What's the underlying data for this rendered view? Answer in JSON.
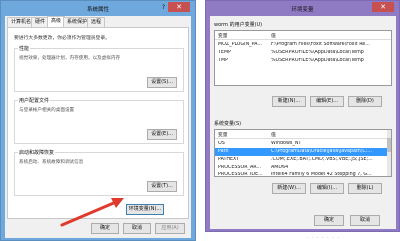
{
  "sysprops": {
    "title": "系统属性",
    "close_glyph": "✕",
    "help_glyph": "?",
    "tabs": [
      "计算机名",
      "硬件",
      "高级",
      "系统保护",
      "远程"
    ],
    "note": "要进行大多数更改，你必须作为管理员登录。",
    "groups": [
      {
        "title": "性能",
        "desc": "视觉效果，处理器计划，内存使用，以及虚拟内存",
        "button": "设置(S)..."
      },
      {
        "title": "用户配置文件",
        "desc": "与登录帐户相关的桌面设置",
        "button": "设置(E)..."
      },
      {
        "title": "启动和故障恢复",
        "desc": "系统启动、系统故障和调试信息",
        "button": "设置(T)..."
      }
    ],
    "env_button": "环境变量(N)...",
    "ok": "确定",
    "cancel": "取消",
    "apply": "应用(A)"
  },
  "envvars": {
    "title": "环境变量",
    "close_glyph": "✕",
    "user_section": "worm 的用户变量(U)",
    "system_section": "系统变量(S)",
    "col_var": "变量",
    "col_val": "值",
    "user_vars": [
      {
        "name": "MOZ_PLUGIN_PA...",
        "value": "F:\\Program Files\\Foxit Software\\Foxit Re..."
      },
      {
        "name": "TEMP",
        "value": "%USERPROFILE%\\AppData\\Local\\Temp"
      },
      {
        "name": "TMP",
        "value": "%USERPROFILE%\\AppData\\Local\\Temp"
      }
    ],
    "system_vars": [
      {
        "name": "OS",
        "value": "Windows_NT"
      },
      {
        "name": "Path",
        "value": "C:\\ProgramData\\Oracle\\Java\\javapath;C:..."
      },
      {
        "name": "PATHEXT",
        "value": ".COM;.EXE;.BAT;.CMD;.VBS;.VBE;.JS;.JSE;..."
      },
      {
        "name": "PROCESSOR_AR...",
        "value": "AMD64"
      },
      {
        "name": "PROCESSOR_IDE...",
        "value": "Intel64 Family 6 Model 42 Stepping 7, G..."
      }
    ],
    "new_user": "新建(N)...",
    "edit_user": "编辑(E)...",
    "delete_user": "删除(D)",
    "new_sys": "新建(W)...",
    "edit_sys": "编辑(I)...",
    "delete_sys": "删除(L)",
    "ok": "确定",
    "cancel": "取消"
  },
  "colors": {
    "sysprops_titlebar": "#6fa8dc",
    "envvars_titlebar": "#8e7bc4",
    "close_button": "#c75050",
    "selection": "#3399ff",
    "arrow": "#e03a2f"
  },
  "icons": [
    "close-icon",
    "help-icon",
    "arrow-annotation"
  ],
  "decor": "· · · · · · ·"
}
